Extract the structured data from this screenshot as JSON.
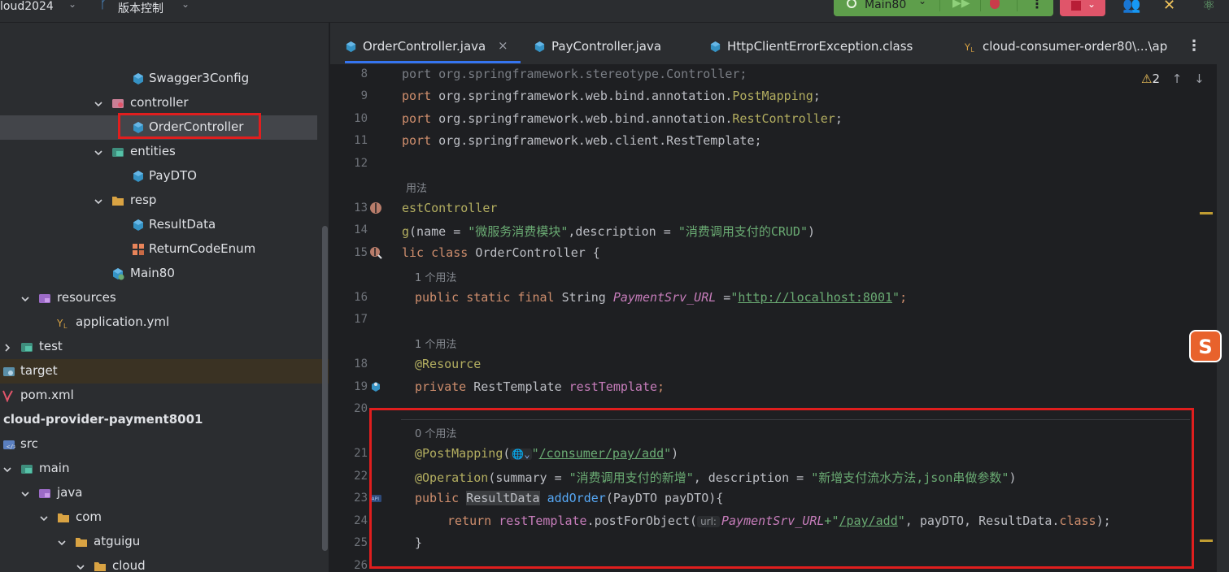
{
  "topbar": {
    "project_name": "loud2024",
    "vcs_label": "版本控制",
    "run_config": "Main80"
  },
  "tree": [
    {
      "label": "Swagger3Config",
      "icon": "class-icon"
    },
    {
      "label": "controller",
      "icon": "package-icon"
    },
    {
      "label": "OrderController",
      "icon": "class-icon"
    },
    {
      "label": "entities",
      "icon": "package-icon"
    },
    {
      "label": "PayDTO",
      "icon": "class-icon"
    },
    {
      "label": "resp",
      "icon": "folder-icon"
    },
    {
      "label": "ResultData",
      "icon": "class-icon"
    },
    {
      "label": "ReturnCodeEnum",
      "icon": "enum-icon"
    },
    {
      "label": "Main80",
      "icon": "spring-boot-class-icon"
    },
    {
      "label": "resources",
      "icon": "resources-folder-icon"
    },
    {
      "label": "application.yml",
      "icon": "yaml-icon"
    },
    {
      "label": "test",
      "icon": "test-folder-icon"
    },
    {
      "label": "target",
      "icon": "excluded-folder-icon"
    },
    {
      "label": "pom.xml",
      "icon": "maven-icon"
    },
    {
      "label": "cloud-provider-payment8001",
      "icon": "module-icon"
    },
    {
      "label": "src",
      "icon": "source-folder-icon"
    },
    {
      "label": "main",
      "icon": "folder-icon"
    },
    {
      "label": "java",
      "icon": "source-root-icon"
    },
    {
      "label": "com",
      "icon": "folder-icon"
    },
    {
      "label": "atguigu",
      "icon": "folder-icon"
    },
    {
      "label": "cloud",
      "icon": "folder-icon"
    }
  ],
  "tabs": [
    {
      "label": "OrderController.java",
      "close": "×"
    },
    {
      "label": "PayController.java"
    },
    {
      "label": "HttpClientErrorException.class"
    },
    {
      "label": "cloud-consumer-order80\\...\\ap"
    }
  ],
  "editor": {
    "warnings": "2",
    "line_numbers": [
      "8",
      "9",
      "10",
      "11",
      "12",
      "13",
      "14",
      "15",
      "16",
      "17",
      "18",
      "19",
      "20",
      "21",
      "22",
      "23",
      "24",
      "25",
      "26"
    ],
    "usage_hints": {
      "h1": "用法",
      "h2": "1 个用法",
      "h3": "1 个用法",
      "h4": "0 个用法"
    },
    "code": {
      "l8_a": "port ",
      "l8_b": "org.springframework.stereotype.Controller;",
      "l9_a": "port ",
      "l9_b": "org.springframework.web.bind.annotation.",
      "l9_c": "PostMapping",
      "l10_a": "port ",
      "l10_b": "org.springframework.web.bind.annotation.",
      "l10_c": "RestController",
      "l11_a": "port ",
      "l11_b": "org.springframework.web.client.RestTemplate;",
      "l13": "estController",
      "l14_a": "g",
      "l14_b": "(name = ",
      "l14_c": "\"微服务消费模块\"",
      "l14_d": ",description = ",
      "l14_e": "\"消费调用支付的CRUD\"",
      "l14_f": ")",
      "l15_a": "lic ",
      "l15_b": "class ",
      "l15_c": "OrderController {",
      "l16_a": "public static final ",
      "l16_b": "String ",
      "l16_c": "PaymentSrv_URL",
      "l16_d": " =",
      "l16_e": "\"",
      "l16_f": "http://localhost:8001",
      "l16_g": "\"",
      "l16_h": ";",
      "l18": "@Resource",
      "l19_a": "private ",
      "l19_b": "RestTemplate ",
      "l19_c": "restTemplate",
      "l19_d": ";",
      "l21_a": "@PostMapping",
      "l21_b": "(",
      "l21_globe": "🌐⌄",
      "l21_c": "\"",
      "l21_d": "/consumer/pay/add",
      "l21_e": "\"",
      "l21_f": ")",
      "l22_a": "@Operation",
      "l22_b": "(summary = ",
      "l22_c": "\"消费调用支付的新增\"",
      "l22_d": ", description = ",
      "l22_e": "\"新增支付流水方法,json串做参数\"",
      "l22_f": ")",
      "l23_a": "public ",
      "l23_b": "ResultData",
      "l23_c": " ",
      "l23_d": "addOrder",
      "l23_e": "(PayDTO payDTO){",
      "l24_a": "return ",
      "l24_b": "restTemplate",
      "l24_c": ".postForObject(",
      "l24_chip": "url:",
      "l24_d": "PaymentSrv_URL",
      "l24_e": "+\"",
      "l24_f": "/pay/add",
      "l24_g": "\"",
      "l24_h": ", payDTO, ResultData.",
      "l24_i": "class",
      "l24_j": ");",
      "l25": "}"
    }
  },
  "colors": {
    "background": "#1e1f22",
    "panel": "#2b2d30",
    "highlight_box": "#e01e1e",
    "run_green": "#5e9e4b",
    "stop_red": "#e0556a"
  }
}
